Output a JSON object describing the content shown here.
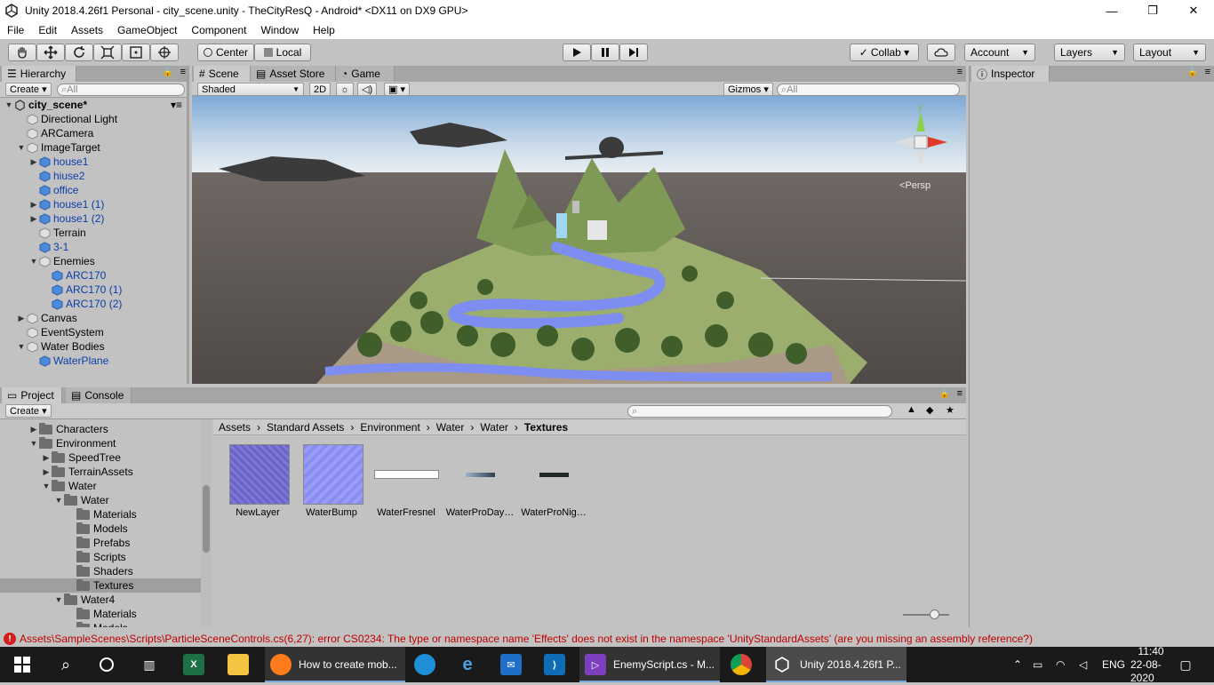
{
  "window": {
    "title": "Unity 2018.4.26f1 Personal - city_scene.unity - TheCityResQ - Android* <DX11 on DX9 GPU>",
    "minimize": "—",
    "maximize": "❐",
    "close": "✕"
  },
  "menu": [
    "File",
    "Edit",
    "Assets",
    "GameObject",
    "Component",
    "Window",
    "Help"
  ],
  "toolbar": {
    "pivot": "Center",
    "space": "Local",
    "collab": "Collab ▾",
    "account": "Account",
    "layers": "Layers",
    "layout": "Layout"
  },
  "hierarchy": {
    "tab": "Hierarchy",
    "create": "Create",
    "search_placeholder": "All",
    "scene": "city_scene*",
    "items": [
      {
        "label": "Directional Light",
        "indent": 0,
        "arrow": "",
        "blue": false
      },
      {
        "label": "ARCamera",
        "indent": 0,
        "arrow": "",
        "blue": false
      },
      {
        "label": "ImageTarget",
        "indent": 0,
        "arrow": "▼",
        "blue": false
      },
      {
        "label": "house1",
        "indent": 1,
        "arrow": "▶",
        "blue": true
      },
      {
        "label": "hiuse2",
        "indent": 1,
        "arrow": "",
        "blue": true
      },
      {
        "label": "office",
        "indent": 1,
        "arrow": "",
        "blue": true
      },
      {
        "label": "house1 (1)",
        "indent": 1,
        "arrow": "▶",
        "blue": true
      },
      {
        "label": "house1 (2)",
        "indent": 1,
        "arrow": "▶",
        "blue": true
      },
      {
        "label": "Terrain",
        "indent": 1,
        "arrow": "",
        "blue": false
      },
      {
        "label": "3-1",
        "indent": 1,
        "arrow": "",
        "blue": true
      },
      {
        "label": "Enemies",
        "indent": 1,
        "arrow": "▼",
        "blue": false
      },
      {
        "label": "ARC170",
        "indent": 2,
        "arrow": "",
        "blue": true
      },
      {
        "label": "ARC170 (1)",
        "indent": 2,
        "arrow": "",
        "blue": true
      },
      {
        "label": "ARC170 (2)",
        "indent": 2,
        "arrow": "",
        "blue": true
      },
      {
        "label": "Canvas",
        "indent": 0,
        "arrow": "▶",
        "blue": false
      },
      {
        "label": "EventSystem",
        "indent": 0,
        "arrow": "",
        "blue": false
      },
      {
        "label": "Water Bodies",
        "indent": 0,
        "arrow": "▼",
        "blue": false
      },
      {
        "label": "WaterPlane",
        "indent": 1,
        "arrow": "",
        "blue": true
      }
    ]
  },
  "scene": {
    "tabs": [
      "Scene",
      "Asset Store",
      "Game"
    ],
    "shading": "Shaded",
    "mode2d": "2D",
    "gizmos": "Gizmos",
    "search_placeholder": "All",
    "persp": "Persp",
    "axis_y": "y"
  },
  "inspector": {
    "tab": "Inspector"
  },
  "project": {
    "tabs": [
      "Project",
      "Console"
    ],
    "create": "Create",
    "tree": [
      {
        "label": "Characters",
        "indent": 0,
        "arrow": "▶",
        "selected": false
      },
      {
        "label": "Environment",
        "indent": 0,
        "arrow": "▼",
        "selected": false
      },
      {
        "label": "SpeedTree",
        "indent": 1,
        "arrow": "▶",
        "selected": false
      },
      {
        "label": "TerrainAssets",
        "indent": 1,
        "arrow": "▶",
        "selected": false
      },
      {
        "label": "Water",
        "indent": 1,
        "arrow": "▼",
        "selected": false
      },
      {
        "label": "Water",
        "indent": 2,
        "arrow": "▼",
        "selected": false
      },
      {
        "label": "Materials",
        "indent": 3,
        "arrow": "",
        "selected": false
      },
      {
        "label": "Models",
        "indent": 3,
        "arrow": "",
        "selected": false
      },
      {
        "label": "Prefabs",
        "indent": 3,
        "arrow": "",
        "selected": false
      },
      {
        "label": "Scripts",
        "indent": 3,
        "arrow": "",
        "selected": false
      },
      {
        "label": "Shaders",
        "indent": 3,
        "arrow": "",
        "selected": false
      },
      {
        "label": "Textures",
        "indent": 3,
        "arrow": "",
        "selected": true
      },
      {
        "label": "Water4",
        "indent": 2,
        "arrow": "▼",
        "selected": false
      },
      {
        "label": "Materials",
        "indent": 3,
        "arrow": "",
        "selected": false
      },
      {
        "label": "Models",
        "indent": 3,
        "arrow": "",
        "selected": false
      }
    ],
    "breadcrumb": [
      "Assets",
      "Standard Assets",
      "Environment",
      "Water",
      "Water",
      "Textures"
    ],
    "assets": [
      "NewLayer",
      "WaterBump",
      "WaterFresnel",
      "WaterProDay…",
      "WaterProNig…"
    ]
  },
  "status": {
    "message": "Assets\\SampleScenes\\Scripts\\ParticleSceneControls.cs(6,27): error CS0234: The type or namespace name 'Effects' does not exist in the namespace 'UnityStandardAssets' (are you missing an assembly reference?)"
  },
  "taskbar": {
    "firefox": "How to create mob...",
    "vs": "EnemyScript.cs - M...",
    "unity": "Unity 2018.4.26f1 P...",
    "lang": "ENG",
    "time": "11:40",
    "date": "22-08-2020"
  },
  "colors": {
    "accent_blue": "#0b3da8",
    "error_red": "#c00000",
    "taskbar": "#1a1a1a"
  }
}
